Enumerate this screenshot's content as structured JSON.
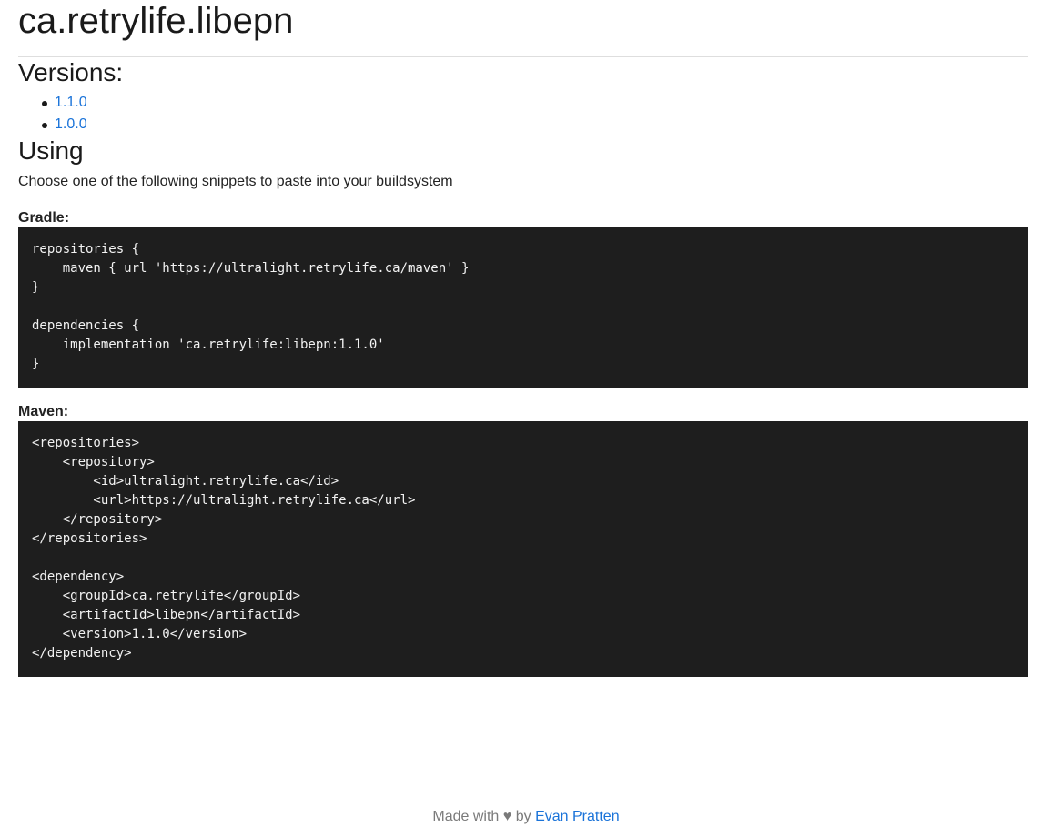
{
  "header": {
    "title": "ca.retrylife.libepn"
  },
  "versions": {
    "heading": "Versions:",
    "items": [
      {
        "label": "1.1.0"
      },
      {
        "label": "1.0.0"
      }
    ]
  },
  "using": {
    "heading": "Using",
    "intro": "Choose one of the following snippets to paste into your buildsystem",
    "gradle": {
      "label": "Gradle:",
      "code": "repositories {\n    maven { url 'https://ultralight.retrylife.ca/maven' }\n}\n\ndependencies {\n    implementation 'ca.retrylife:libepn:1.1.0'\n}"
    },
    "maven": {
      "label": "Maven:",
      "code": "<repositories>\n    <repository>\n        <id>ultralight.retrylife.ca</id>\n        <url>https://ultralight.retrylife.ca</url>\n    </repository>\n</repositories>\n\n<dependency>\n    <groupId>ca.retrylife</groupId>\n    <artifactId>libepn</artifactId>\n    <version>1.1.0</version>\n</dependency>"
    }
  },
  "footer": {
    "made_with": "Made with",
    "heart": "♥",
    "by": "by",
    "author": "Evan Pratten"
  },
  "colors": {
    "link": "#1a73d9",
    "code_background": "#1e1e1e",
    "footer_text": "#7a7a7a"
  }
}
